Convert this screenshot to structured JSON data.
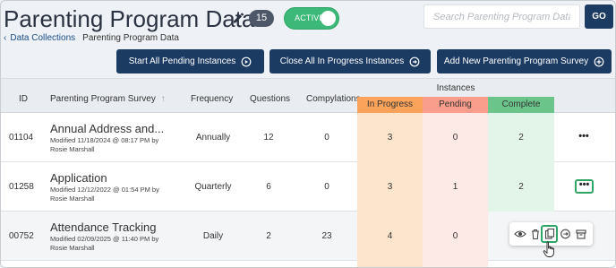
{
  "header": {
    "title": "Parenting Program Data",
    "count": "15",
    "status_toggle": "ACTIVE",
    "search_placeholder": "Search Parenting Program Data",
    "go_label": "GO"
  },
  "breadcrumb": {
    "parent": "Data Collections",
    "current": "Parenting Program Data"
  },
  "actions": {
    "start_pending": "Start All Pending Instances",
    "close_in_progress": "Close All In Progress Instances",
    "add_survey": "Add New Parenting Program Survey"
  },
  "table": {
    "columns": {
      "id": "ID",
      "survey": "Parenting Program Survey",
      "frequency": "Frequency",
      "questions": "Questions",
      "compylations": "Compylations",
      "instances": "Instances",
      "in_progress": "In Progress",
      "pending": "Pending",
      "complete": "Complete"
    },
    "rows": [
      {
        "id": "01104",
        "name": "Annual Address and...",
        "modified": "Modified 11/18/2024 @ 08:17 PM by",
        "author": "Rosie Marshall",
        "frequency": "Annually",
        "questions": "12",
        "compylations": "0",
        "in_progress": "3",
        "pending": "0",
        "complete": "2",
        "more": "•••"
      },
      {
        "id": "01258",
        "name": "Application",
        "modified": "Modified 12/12/2022 @ 01:54 PM by",
        "author": "Rosie Marshall",
        "frequency": "Quarterly",
        "questions": "6",
        "compylations": "0",
        "in_progress": "3",
        "pending": "1",
        "complete": "2",
        "more": "•••"
      },
      {
        "id": "00752",
        "name": "Attendance Tracking",
        "modified": "Modified 02/09/2025 @ 11:40 PM by",
        "author": "Rosie Marshall",
        "frequency": "Daily",
        "questions": "2",
        "compylations": "23",
        "in_progress": "4",
        "pending": "0",
        "complete": ""
      }
    ]
  },
  "colors": {
    "primary": "#1c3b63",
    "active_green": "#3cb878",
    "in_progress": "#fba35b",
    "pending": "#f99d8c",
    "complete": "#6bc58a"
  },
  "icons": [
    "pencil-icon",
    "refresh-play-icon",
    "close-circle-icon",
    "plus-circle-icon",
    "sort-arrow-icon",
    "eye-icon",
    "trash-icon",
    "copy-icon",
    "archive-icon",
    "cursor-hand-icon"
  ]
}
